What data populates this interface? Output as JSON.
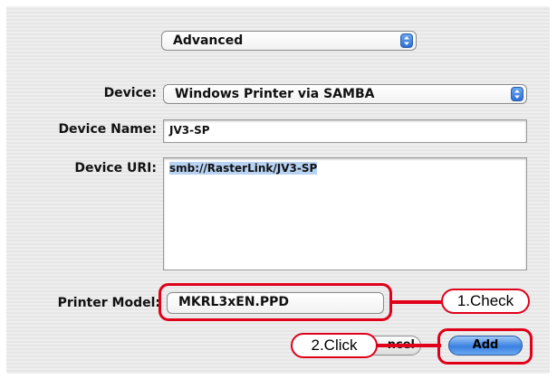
{
  "dialog": {
    "mode_select": "Advanced",
    "device_label": "Device:",
    "device_value": "Windows Printer via SAMBA",
    "device_name_label": "Device Name:",
    "device_name_value": "JV3-SP",
    "device_uri_label": "Device URI:",
    "device_uri_value": "smb://RasterLink/JV3-SP",
    "printer_model_label": "Printer Model:",
    "printer_model_value": "MKRL3xEN.PPD",
    "cancel_label": "ncel",
    "add_label": "Add"
  },
  "annotations": {
    "check_callout": "1.Check",
    "click_callout": "2.Click",
    "highlight_color": "#e0001a"
  },
  "icons": {
    "stepper": "up-down-arrows-icon"
  }
}
